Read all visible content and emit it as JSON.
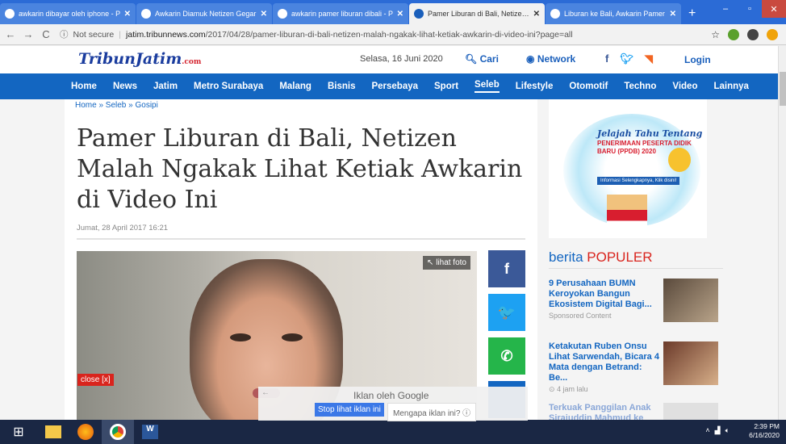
{
  "browser": {
    "tabs": [
      {
        "title": "awkarin dibayar oleh iphone - P",
        "favicon": "google-icon",
        "color": "#fff",
        "active": false
      },
      {
        "title": "Awkarin Diamuk Netizen Gegar",
        "favicon": "site-icon",
        "color": "#fff",
        "active": false
      },
      {
        "title": "awkarin pamer liburan dibali - P",
        "favicon": "google-icon",
        "color": "#fff",
        "active": false
      },
      {
        "title": "Pamer Liburan di Bali, Netizen M",
        "favicon": "tribun-icon",
        "color": "#1a5fbb",
        "active": true
      },
      {
        "title": "Liburan ke Bali, Awkarin Pamer",
        "favicon": "video-icon",
        "color": "#fff",
        "active": false
      }
    ],
    "new_tab": "+",
    "window_controls": [
      "–",
      "▫",
      "✕"
    ],
    "nav": {
      "back": "←",
      "forward": "→",
      "reload": "C"
    },
    "address": {
      "security": "Not secure",
      "host": "jatim.tribunnews.com",
      "path": "/2017/04/28/pamer-liburan-di-bali-netizen-malah-ngakak-lihat-ketiak-awkarin-di-video-ini?page=all",
      "star": "☆"
    }
  },
  "site": {
    "logo_main": "TribunJatim",
    "logo_suffix": ".com",
    "date": "Selasa, 16 Juni 2020",
    "search_label": "Cari",
    "network_label": "Network",
    "login_label": "Login",
    "nav_items": [
      "Home",
      "News",
      "Jatim",
      "Metro Surabaya",
      "Malang",
      "Bisnis",
      "Persebaya",
      "Sport",
      "Seleb",
      "Lifestyle",
      "Otomotif",
      "Techno",
      "Video",
      "Lainnya"
    ],
    "nav_selected": "Seleb",
    "brand_color": "#1366c1"
  },
  "article": {
    "breadcrumb": "Home » Seleb » Gosipi",
    "title": "Pamer Liburan di Bali, Netizen Malah Ngakak Lihat Ketiak Awkarin di Video Ini",
    "date": "Jumat, 28 April 2017 16:21",
    "photo_label": "↖ lihat foto",
    "close_label": "close [x]",
    "share": [
      {
        "name": "facebook-share",
        "glyph": "f",
        "color": "#3b5998"
      },
      {
        "name": "twitter-share",
        "glyph": "🐦",
        "color": "#1da1f2"
      },
      {
        "name": "whatsapp-share",
        "glyph": "✆",
        "color": "#25b54a"
      },
      {
        "name": "more-share",
        "glyph": "",
        "color": "#1366c1"
      }
    ]
  },
  "ad_banner": {
    "line1": "Jelajah Tahu Tentang",
    "line2": "PENERIMAAN PESERTA DIDIK BARU (PPDB) 2020",
    "cta": "Informasi Selengkapnya, Klik disini!"
  },
  "populer": {
    "heading_a": "berita",
    "heading_b": "POPULER",
    "items": [
      {
        "title": "9 Perusahaan BUMN Keroyokan Bangun Ekosistem Digital Bagi...",
        "sub": "Sponsored Content"
      },
      {
        "title": "Ketakutan Ruben Onsu Lihat Sarwendah, Bicara 4 Mata dengan Betrand: Be...",
        "sub": "⊙ 4 jam lalu"
      },
      {
        "title": "Terkuak Panggilan Anak Sirajuddin Mahmud ke",
        "sub": ""
      }
    ]
  },
  "ad_overlay": {
    "label": "Iklan oleh Google",
    "back": "←",
    "stop": "Stop lihat iklan ini",
    "why": "Mengapa iklan ini? ⓘ"
  },
  "taskbar": {
    "time": "2:39 PM",
    "date": "6/16/2020"
  }
}
